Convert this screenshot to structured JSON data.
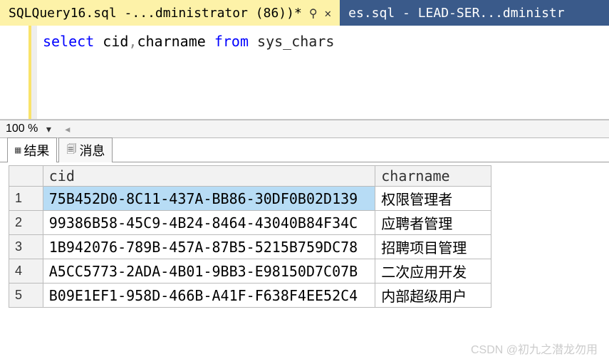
{
  "tabs": {
    "active": {
      "label": "SQLQuery16.sql -...dministrator (86))*",
      "pin": "⚲",
      "close": "✕"
    },
    "inactive": {
      "label": "es.sql - LEAD-SER...dministr"
    }
  },
  "editor": {
    "kw_select": "select",
    "cols": " cid",
    "comma": ",",
    "col2": "charname ",
    "kw_from": "from",
    "tbl": " sys_chars"
  },
  "zoom": {
    "value": "100 %",
    "chevron": "▾",
    "left_arrow": "◂"
  },
  "result_tabs": {
    "results": {
      "label": "结果"
    },
    "messages": {
      "label": "消息"
    }
  },
  "grid": {
    "headers": {
      "rownum": "",
      "cid": "cid",
      "charname": "charname"
    },
    "rows": [
      {
        "n": "1",
        "cid": "75B452D0-8C11-437A-BB86-30DF0B02D139",
        "charname": "权限管理者"
      },
      {
        "n": "2",
        "cid": "99386B58-45C9-4B24-8464-43040B84F34C",
        "charname": "应聘者管理"
      },
      {
        "n": "3",
        "cid": "1B942076-789B-457A-87B5-5215B759DC78",
        "charname": "招聘项目管理"
      },
      {
        "n": "4",
        "cid": "A5CC5773-2ADA-4B01-9BB3-E98150D7C07B",
        "charname": "二次应用开发"
      },
      {
        "n": "5",
        "cid": "B09E1EF1-958D-466B-A41F-F638F4EE52C4",
        "charname": "内部超级用户"
      }
    ]
  },
  "watermark": "CSDN @初九之潜龙勿用"
}
